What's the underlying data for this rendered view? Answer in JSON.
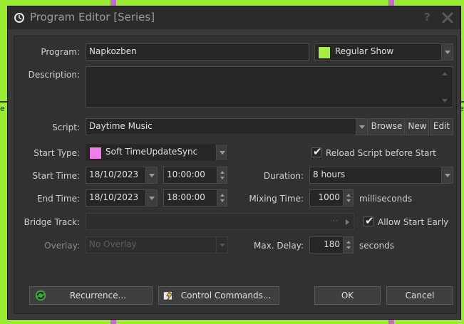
{
  "window": {
    "title": "Program Editor [Series]",
    "help_glyph": "?"
  },
  "background": {
    "edge_left": "e",
    "edge_right": "e"
  },
  "form": {
    "program": {
      "label": "Program:",
      "value": "Napkozben"
    },
    "category": {
      "value": "Regular Show",
      "color": "#a8f040"
    },
    "description": {
      "label": "Description:",
      "value": ""
    },
    "script": {
      "label": "Script:",
      "value": "Daytime Music",
      "browse_label": "Browse",
      "new_label": "New",
      "edit_label": "Edit"
    },
    "start_type": {
      "label": "Start Type:",
      "value": "Soft TimeUpdateSync",
      "color": "#f07ee8"
    },
    "reload_script": {
      "label": "Reload Script before Start",
      "checked": true
    },
    "start_time": {
      "label": "Start Time:",
      "date": "18/10/2023",
      "time": "10:00:00"
    },
    "duration": {
      "label": "Duration:",
      "value": "8 hours"
    },
    "end_time": {
      "label": "End Time:",
      "date": "18/10/2023",
      "time": "18:00:00"
    },
    "mixing_time": {
      "label": "Mixing Time:",
      "value": "1000",
      "unit": "milliseconds"
    },
    "bridge_track": {
      "label": "Bridge Track:",
      "value": "",
      "ellipsis": "···"
    },
    "allow_start_early": {
      "label": "Allow Start Early",
      "checked": true
    },
    "overlay": {
      "label": "Overlay:",
      "value": "No Overlay"
    },
    "max_delay": {
      "label": "Max. Delay:",
      "value": "180",
      "unit": "seconds"
    }
  },
  "buttons": {
    "recurrence_label": "Recurrence...",
    "control_commands_label": "Control Commands...",
    "ok_label": "OK",
    "cancel_label": "Cancel"
  }
}
